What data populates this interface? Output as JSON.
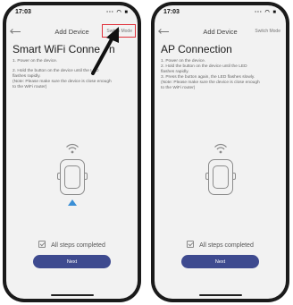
{
  "screens": [
    {
      "status": {
        "time": "17:03",
        "icons": "⋅⋅⋅ ◠ ■"
      },
      "nav": {
        "title": "Add Device",
        "switch_mode": "Switch Mode"
      },
      "heading": "Smart WiFi Connection",
      "heading_visible": "Smart WiFi Conne",
      "heading_tail": "n",
      "steps": [
        "1. Power on the device.",
        "2. Hold the button on the device until the LED",
        "flashes rapidly.",
        "(Note: Please make sure the device is close enough",
        "to the WiFi router)"
      ],
      "checkbox_label": "All steps completed",
      "next_label": "Next"
    },
    {
      "status": {
        "time": "17:03",
        "icons": "⋅⋅⋅ ◠ ■"
      },
      "nav": {
        "title": "Add Device",
        "switch_mode": "Switch Mode"
      },
      "heading": "AP Connection",
      "steps": [
        "1. Power on the device.",
        "2. Hold the button on the device until the LED",
        "flashes rapidly.",
        "3. Press the button again,  the LED flashes slowly.",
        "(Note: Please make sure the device is close enough",
        "to the WiFi router)"
      ],
      "checkbox_label": "All steps completed",
      "next_label": "Next"
    }
  ],
  "annotation": {
    "highlight_color": "#e0303a",
    "arrow_color": "#111111"
  },
  "colors": {
    "button": "#3e4a8f",
    "indicator": "#3b8fd6"
  },
  "icons": [
    "back-arrow-icon",
    "wifi-signal-icon",
    "device-icon",
    "up-triangle-icon",
    "checkbox-icon"
  ]
}
